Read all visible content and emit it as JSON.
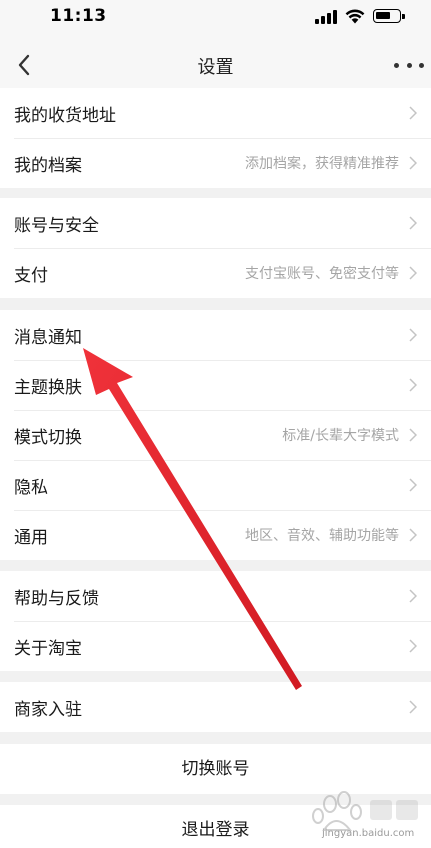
{
  "status_bar": {
    "time": "11:13"
  },
  "nav": {
    "title": "设置",
    "back_icon": "chevron-left-icon",
    "more_icon": "more-dots-icon"
  },
  "groups": [
    {
      "rows": [
        {
          "label": "我的收货地址",
          "desc": ""
        },
        {
          "label": "我的档案",
          "desc": "添加档案，获得精准推荐"
        }
      ]
    },
    {
      "rows": [
        {
          "label": "账号与安全",
          "desc": ""
        },
        {
          "label": "支付",
          "desc": "支付宝账号、免密支付等"
        }
      ]
    },
    {
      "rows": [
        {
          "label": "消息通知",
          "desc": ""
        },
        {
          "label": "主题换肤",
          "desc": ""
        },
        {
          "label": "模式切换",
          "desc": "标准/长辈大字模式"
        },
        {
          "label": "隐私",
          "desc": ""
        },
        {
          "label": "通用",
          "desc": "地区、音效、辅助功能等"
        }
      ]
    },
    {
      "rows": [
        {
          "label": "帮助与反馈",
          "desc": ""
        },
        {
          "label": "关于淘宝",
          "desc": ""
        }
      ]
    },
    {
      "rows": [
        {
          "label": "商家入驻",
          "desc": ""
        }
      ]
    }
  ],
  "actions": {
    "switch_account": "切换账号",
    "logout": "退出登录"
  },
  "annotation": {
    "arrow_color": "#e0242c",
    "points_to": "消息通知"
  },
  "watermark": {
    "url": "jingyan.baidu.com"
  },
  "colors": {
    "background": "#f1f1f1",
    "row_bg": "#ffffff",
    "label": "#1a1a1a",
    "desc": "#a5a5a5"
  }
}
